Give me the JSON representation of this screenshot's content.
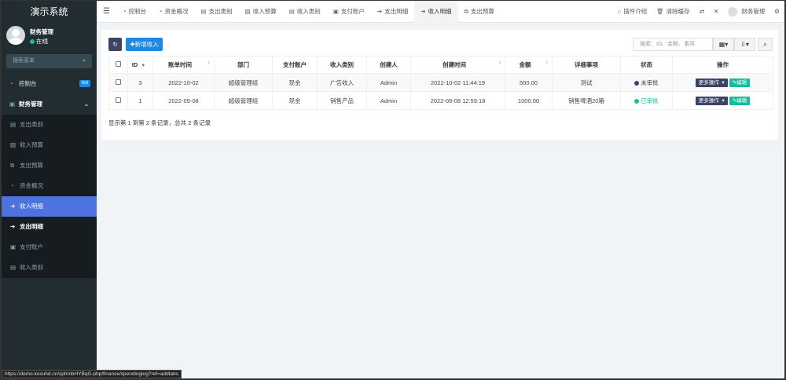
{
  "app": {
    "title": "演示系统"
  },
  "user": {
    "name": "财务管理",
    "status": "在线"
  },
  "sidebar": {
    "search_placeholder": "搜索菜单",
    "items": [
      {
        "label": "控制台",
        "badge": "hot",
        "icon": "dashboard-icon"
      },
      {
        "label": "财务管理",
        "icon": "money-icon"
      }
    ],
    "sub_items": [
      {
        "label": "支出类别",
        "icon": "list-icon"
      },
      {
        "label": "收入预算",
        "icon": "image-icon"
      },
      {
        "label": "支出预算",
        "icon": "object-icon"
      },
      {
        "label": "资金概况",
        "icon": "dashboard-icon"
      },
      {
        "label": "收入明细",
        "icon": "sign-in-icon"
      },
      {
        "label": "支出明细",
        "icon": "sign-out-icon"
      },
      {
        "label": "支付账户",
        "icon": "user-box-icon"
      },
      {
        "label": "收入类别",
        "icon": "list-icon"
      }
    ]
  },
  "tabs": [
    {
      "label": "控制台"
    },
    {
      "label": "资金概况"
    },
    {
      "label": "支出类别"
    },
    {
      "label": "收入预算"
    },
    {
      "label": "收入类别"
    },
    {
      "label": "支付账户"
    },
    {
      "label": "支出明细"
    },
    {
      "label": "收入明细"
    },
    {
      "label": "支出预算"
    }
  ],
  "topright": {
    "plugin": "插件介绍",
    "clear_cache": "清除缓存",
    "user": "财务管理"
  },
  "toolbar": {
    "add": "新增收入",
    "search_placeholder": "搜索：ID、金额、事项"
  },
  "table": {
    "headers": [
      "ID",
      "账单时间",
      "部门",
      "支付账户",
      "收入类别",
      "创建人",
      "创建时间",
      "金额",
      "详细事项",
      "状态",
      "操作"
    ],
    "rows": [
      {
        "id": "3",
        "bill_date": "2022-10-02",
        "dept": "超级管理组",
        "account": "现金",
        "category": "广告收入",
        "creator": "Admin",
        "created": "2022-10-02 11:44:19",
        "amount": "500.00",
        "detail": "测试",
        "status": "未审批"
      },
      {
        "id": "1",
        "bill_date": "2022-09-08",
        "dept": "超级管理组",
        "account": "现金",
        "category": "销售产品",
        "creator": "Admin",
        "created": "2022-09-08 12:59:18",
        "amount": "1000.00",
        "detail": "销售啤酒20箱",
        "status": "已审批"
      }
    ],
    "more_label": "更多操作",
    "edit_label": "编辑"
  },
  "pagination": {
    "summary": "显示第 1 到第 2 条记录，总共 2 条记录"
  },
  "statusbar": {
    "url": "https://demo.kosuhd.cn/sphmbHYBqG.php/finance/spendinglog?ref=addtabs"
  }
}
